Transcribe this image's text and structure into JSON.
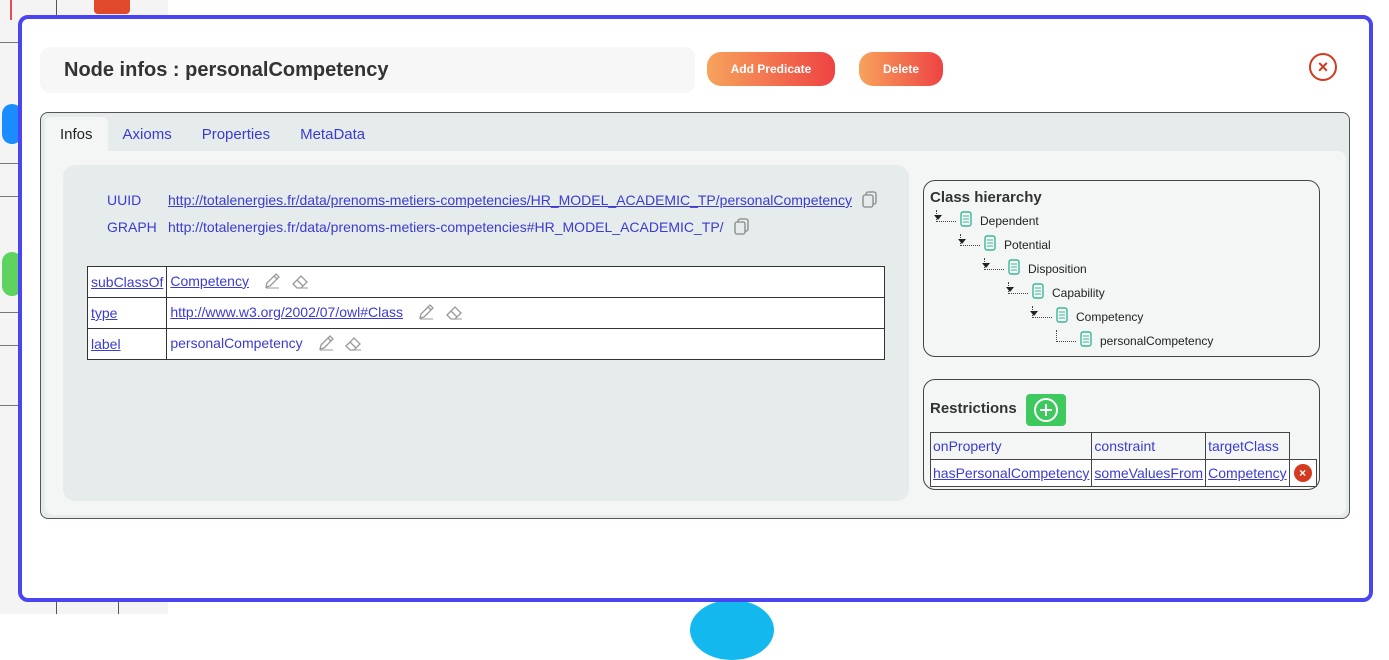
{
  "modal": {
    "title": "Node infos : personalCompetency",
    "add_predicate_label": "Add Predicate",
    "delete_label": "Delete",
    "close_icon": "close-icon",
    "accent_color": "#4a45f0"
  },
  "tabs": [
    {
      "label": "Infos",
      "active": true
    },
    {
      "label": "Axioms",
      "active": false
    },
    {
      "label": "Properties",
      "active": false
    },
    {
      "label": "MetaData",
      "active": false
    }
  ],
  "infos": {
    "uuid_label": "UUID",
    "uuid_value": "http://totalenergies.fr/data/prenoms-metiers-competencies/HR_MODEL_ACADEMIC_TP/personalCompetency",
    "graph_label": "GRAPH",
    "graph_value": "http://totalenergies.fr/data/prenoms-metiers-competencies#HR_MODEL_ACADEMIC_TP/",
    "properties": [
      {
        "key": "subClassOf",
        "value": "Competency",
        "value_is_link": true
      },
      {
        "key": "type",
        "value": "http://www.w3.org/2002/07/owl#Class",
        "value_is_link": true
      },
      {
        "key": "label",
        "value": "personalCompetency",
        "value_is_link": false
      }
    ]
  },
  "class_hierarchy": {
    "title": "Class hierarchy",
    "nodes": [
      "Dependent",
      "Potential",
      "Disposition",
      "Capability",
      "Competency",
      "personalCompetency"
    ]
  },
  "restrictions": {
    "title": "Restrictions",
    "headers": [
      "onProperty",
      "constraint",
      "targetClass"
    ],
    "rows": [
      {
        "onProperty": "hasPersonalCompetency",
        "constraint": "someValuesFrom",
        "targetClass": "Competency"
      }
    ]
  }
}
